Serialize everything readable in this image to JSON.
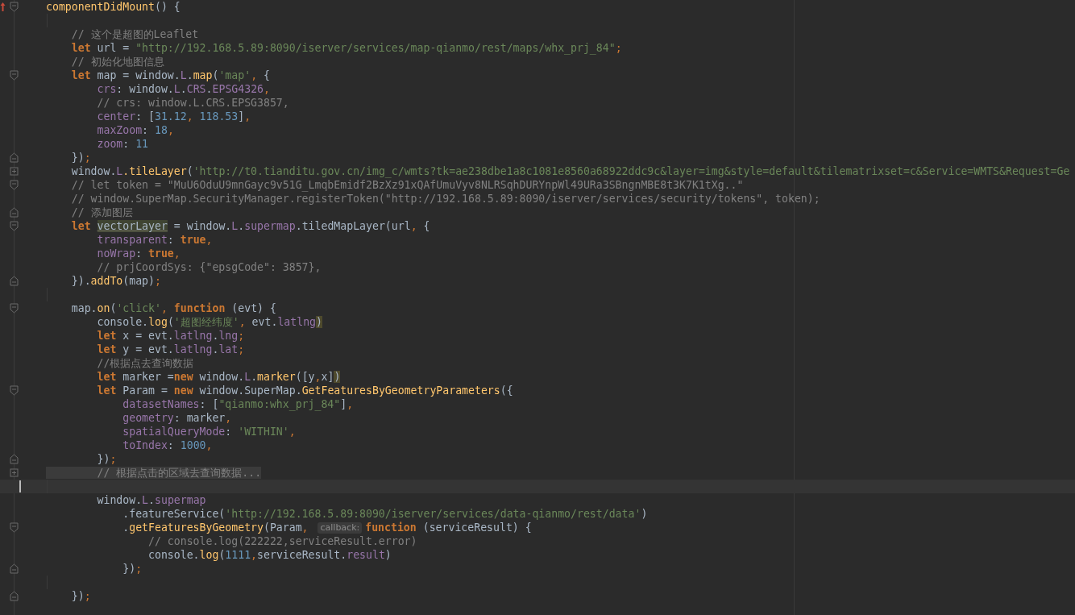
{
  "editor": {
    "lines": [
      {
        "fold": {
          "kind": "open"
        },
        "gutter_icon": {
          "kind": "override"
        },
        "tokens": [
          {
            "text": "componentDidMount",
            "kind": "f"
          },
          {
            "text": "() {",
            "kind": "p"
          }
        ]
      },
      {
        "kind": "blank"
      },
      {
        "tokens": [
          {
            "text": "    // 这个是超图的Leaflet",
            "kind": "c"
          }
        ]
      },
      {
        "tokens": [
          {
            "text": "    let",
            "kind": "kw"
          },
          {
            "text": " url = ",
            "kind": "p"
          },
          {
            "text": "\"http://192.168.5.89:8090/iserver/services/map-qianmo/rest/maps/whx_prj_84\"",
            "kind": "s"
          },
          {
            "text": ";",
            "kind": "o"
          }
        ]
      },
      {
        "tokens": [
          {
            "text": "    // 初始化地图信息",
            "kind": "c"
          }
        ]
      },
      {
        "fold": {
          "kind": "open"
        },
        "tokens": [
          {
            "text": "    let",
            "kind": "kw"
          },
          {
            "text": " map = window.",
            "kind": "p"
          },
          {
            "text": "L",
            "kind": "pr"
          },
          {
            "text": ".",
            "kind": "p"
          },
          {
            "text": "map",
            "kind": "f"
          },
          {
            "text": "(",
            "kind": "p"
          },
          {
            "text": "'map'",
            "kind": "s"
          },
          {
            "text": ", ",
            "kind": "o"
          },
          {
            "text": "{",
            "kind": "p"
          }
        ]
      },
      {
        "tokens": [
          {
            "text": "        crs",
            "kind": "pr"
          },
          {
            "text": ": window.",
            "kind": "p"
          },
          {
            "text": "L",
            "kind": "pr"
          },
          {
            "text": ".",
            "kind": "p"
          },
          {
            "text": "CRS",
            "kind": "pr"
          },
          {
            "text": ".",
            "kind": "p"
          },
          {
            "text": "EPSG4326",
            "kind": "pr"
          },
          {
            "text": ",",
            "kind": "o"
          }
        ]
      },
      {
        "tokens": [
          {
            "text": "        // crs: window.L.CRS.EPSG3857,",
            "kind": "c"
          }
        ]
      },
      {
        "tokens": [
          {
            "text": "        center",
            "kind": "pr"
          },
          {
            "text": ": [",
            "kind": "p"
          },
          {
            "text": "31.12",
            "kind": "n"
          },
          {
            "text": ", ",
            "kind": "o"
          },
          {
            "text": "118.53",
            "kind": "n"
          },
          {
            "text": "]",
            "kind": "p"
          },
          {
            "text": ",",
            "kind": "o"
          }
        ]
      },
      {
        "tokens": [
          {
            "text": "        maxZoom",
            "kind": "pr"
          },
          {
            "text": ": ",
            "kind": "p"
          },
          {
            "text": "18",
            "kind": "n"
          },
          {
            "text": ",",
            "kind": "o"
          }
        ]
      },
      {
        "tokens": [
          {
            "text": "        zoom",
            "kind": "pr"
          },
          {
            "text": ": ",
            "kind": "p"
          },
          {
            "text": "11",
            "kind": "n"
          }
        ]
      },
      {
        "fold": {
          "kind": "close"
        },
        "tokens": [
          {
            "text": "    })",
            "kind": "p"
          },
          {
            "text": ";",
            "kind": "o"
          }
        ]
      },
      {
        "fold": {
          "kind": "plus"
        },
        "tokens": [
          {
            "text": "    window.",
            "kind": "p"
          },
          {
            "text": "L",
            "kind": "pr"
          },
          {
            "text": ".tileLayer",
            "kind": "f"
          },
          {
            "text": "(",
            "kind": "p"
          },
          {
            "text": "'http://t0.tianditu.gov.cn/img_c/wmts?tk=ae238dbe1a8c1081e8560a68922ddc9c&layer=img&style=default&tilematrixset=c&Service=WMTS&Request=Ge",
            "kind": "s"
          }
        ]
      },
      {
        "fold": {
          "kind": "open"
        },
        "tokens": [
          {
            "text": "    // let token = \"MuU6OduU9mnGayc9v51G_LmqbEmidf2BzXz91xQAfUmuVyv8NLRSqhDURYnpWl49URa3SBngnMBE8t3K7K1tXg..\"",
            "kind": "c"
          }
        ]
      },
      {
        "tokens": [
          {
            "text": "    // window.SuperMap.SecurityManager.registerToken(\"http://192.168.5.89:8090/iserver/services/security/tokens\", token);",
            "kind": "c"
          }
        ]
      },
      {
        "fold": {
          "kind": "close"
        },
        "tokens": [
          {
            "text": "    // 添加图层",
            "kind": "c"
          }
        ]
      },
      {
        "fold": {
          "kind": "open"
        },
        "tokens": [
          {
            "text": "    let ",
            "kind": "kw"
          },
          {
            "text": "vectorLayer",
            "kind": "d"
          },
          {
            "text": " = window.",
            "kind": "p"
          },
          {
            "text": "L",
            "kind": "pr"
          },
          {
            "text": ".",
            "kind": "p"
          },
          {
            "text": "supermap",
            "kind": "pr"
          },
          {
            "text": ".tiledMapLayer(url",
            "kind": "p"
          },
          {
            "text": ", ",
            "kind": "o"
          },
          {
            "text": "{",
            "kind": "p"
          }
        ]
      },
      {
        "tokens": [
          {
            "text": "        transparent",
            "kind": "pr"
          },
          {
            "text": ": ",
            "kind": "p"
          },
          {
            "text": "true",
            "kind": "kw"
          },
          {
            "text": ",",
            "kind": "o"
          }
        ]
      },
      {
        "tokens": [
          {
            "text": "        noWrap",
            "kind": "pr"
          },
          {
            "text": ": ",
            "kind": "p"
          },
          {
            "text": "true",
            "kind": "kw"
          },
          {
            "text": ",",
            "kind": "o"
          }
        ]
      },
      {
        "tokens": [
          {
            "text": "        // prjCoordSys: {\"epsgCode\": 3857},",
            "kind": "c"
          }
        ]
      },
      {
        "fold": {
          "kind": "close"
        },
        "tokens": [
          {
            "text": "    }).",
            "kind": "p"
          },
          {
            "text": "addTo",
            "kind": "f"
          },
          {
            "text": "(map)",
            "kind": "p"
          },
          {
            "text": ";",
            "kind": "o"
          }
        ]
      },
      {
        "kind": "blank"
      },
      {
        "fold": {
          "kind": "open"
        },
        "tokens": [
          {
            "text": "    map.",
            "kind": "p"
          },
          {
            "text": "on",
            "kind": "f"
          },
          {
            "text": "(",
            "kind": "p"
          },
          {
            "text": "'click'",
            "kind": "s"
          },
          {
            "text": ", ",
            "kind": "o"
          },
          {
            "text": "function",
            "kind": "kw"
          },
          {
            "text": " (evt) {",
            "kind": "p"
          }
        ]
      },
      {
        "tokens": [
          {
            "text": "        console.",
            "kind": "p"
          },
          {
            "text": "log",
            "kind": "f"
          },
          {
            "text": "(",
            "kind": "p"
          },
          {
            "text": "'超图经纬度'",
            "kind": "s"
          },
          {
            "text": ", ",
            "kind": "o"
          },
          {
            "text": "evt.",
            "kind": "p"
          },
          {
            "text": "latlng",
            "kind": "pr"
          },
          {
            "text": ")",
            "kind": "m"
          }
        ]
      },
      {
        "tokens": [
          {
            "text": "        let",
            "kind": "kw"
          },
          {
            "text": " x = evt.",
            "kind": "p"
          },
          {
            "text": "latlng",
            "kind": "pr"
          },
          {
            "text": ".",
            "kind": "p"
          },
          {
            "text": "lng",
            "kind": "pr"
          },
          {
            "text": ";",
            "kind": "o"
          }
        ]
      },
      {
        "tokens": [
          {
            "text": "        let",
            "kind": "kw"
          },
          {
            "text": " y = evt.",
            "kind": "p"
          },
          {
            "text": "latlng",
            "kind": "pr"
          },
          {
            "text": ".",
            "kind": "p"
          },
          {
            "text": "lat",
            "kind": "pr"
          },
          {
            "text": ";",
            "kind": "o"
          }
        ]
      },
      {
        "tokens": [
          {
            "text": "        //根据点去查询数据",
            "kind": "c"
          }
        ]
      },
      {
        "tokens": [
          {
            "text": "        let",
            "kind": "kw"
          },
          {
            "text": " marker =",
            "kind": "p"
          },
          {
            "text": "new",
            "kind": "kw"
          },
          {
            "text": " window.",
            "kind": "p"
          },
          {
            "text": "L",
            "kind": "pr"
          },
          {
            "text": ".",
            "kind": "p"
          },
          {
            "text": "marker",
            "kind": "f"
          },
          {
            "text": "([y",
            "kind": "p"
          },
          {
            "text": ",",
            "kind": "o"
          },
          {
            "text": "x]",
            "kind": "p"
          },
          {
            "text": ")",
            "kind": "m"
          }
        ]
      },
      {
        "fold": {
          "kind": "open"
        },
        "tokens": [
          {
            "text": "        let",
            "kind": "kw"
          },
          {
            "text": " Param = ",
            "kind": "p"
          },
          {
            "text": "new",
            "kind": "kw"
          },
          {
            "text": " window.SuperMap.",
            "kind": "p"
          },
          {
            "text": "GetFeaturesByGeometryParameters",
            "kind": "f"
          },
          {
            "text": "({",
            "kind": "p"
          }
        ]
      },
      {
        "tokens": [
          {
            "text": "            datasetNames",
            "kind": "pr"
          },
          {
            "text": ": [",
            "kind": "p"
          },
          {
            "text": "\"qianmo:whx_prj_84\"",
            "kind": "s"
          },
          {
            "text": "]",
            "kind": "p"
          },
          {
            "text": ",",
            "kind": "o"
          }
        ]
      },
      {
        "tokens": [
          {
            "text": "            geometry",
            "kind": "pr"
          },
          {
            "text": ": marker",
            "kind": "p"
          },
          {
            "text": ",",
            "kind": "o"
          }
        ]
      },
      {
        "tokens": [
          {
            "text": "            spatialQueryMode",
            "kind": "pr"
          },
          {
            "text": ": ",
            "kind": "p"
          },
          {
            "text": "'WITHIN'",
            "kind": "s"
          },
          {
            "text": ",",
            "kind": "o"
          }
        ]
      },
      {
        "tokens": [
          {
            "text": "            toIndex",
            "kind": "pr"
          },
          {
            "text": ": ",
            "kind": "p"
          },
          {
            "text": "1000",
            "kind": "n"
          },
          {
            "text": ",",
            "kind": "o"
          }
        ]
      },
      {
        "fold": {
          "kind": "close"
        },
        "tokens": [
          {
            "text": "        })",
            "kind": "p"
          },
          {
            "text": ";",
            "kind": "o"
          }
        ]
      },
      {
        "fold": {
          "kind": "plus"
        },
        "tokens": [
          {
            "text": "        // 根据点击的区域去查询数据...",
            "kind": "ch"
          }
        ]
      },
      {
        "kind": "blank",
        "current": true
      },
      {
        "tokens": [
          {
            "text": "        window.",
            "kind": "p"
          },
          {
            "text": "L",
            "kind": "pr"
          },
          {
            "text": ".",
            "kind": "p"
          },
          {
            "text": "supermap",
            "kind": "pr"
          }
        ]
      },
      {
        "tokens": [
          {
            "text": "            .featureService(",
            "kind": "p"
          },
          {
            "text": "'http://192.168.5.89:8090/iserver/services/data-qianmo/rest/data'",
            "kind": "s"
          },
          {
            "text": ")",
            "kind": "p"
          }
        ]
      },
      {
        "fold": {
          "kind": "open"
        },
        "tokens": [
          {
            "text": "            .",
            "kind": "p"
          },
          {
            "text": "getFeaturesByGeometry",
            "kind": "f"
          },
          {
            "text": "(Param",
            "kind": "p"
          },
          {
            "text": ", ",
            "kind": "o"
          },
          {
            "text": "callback:",
            "kind": "h"
          },
          {
            "text": "function",
            "kind": "kw"
          },
          {
            "text": " (serviceResult) {",
            "kind": "p"
          }
        ]
      },
      {
        "tokens": [
          {
            "text": "                // console.log(222222,serviceResult.error)",
            "kind": "c"
          }
        ]
      },
      {
        "tokens": [
          {
            "text": "                console.",
            "kind": "p"
          },
          {
            "text": "log",
            "kind": "f"
          },
          {
            "text": "(",
            "kind": "p"
          },
          {
            "text": "1111",
            "kind": "n"
          },
          {
            "text": ",",
            "kind": "o"
          },
          {
            "text": "serviceResult.",
            "kind": "p"
          },
          {
            "text": "result",
            "kind": "pr"
          },
          {
            "text": ")",
            "kind": "p"
          }
        ]
      },
      {
        "fold": {
          "kind": "close"
        },
        "tokens": [
          {
            "text": "            })",
            "kind": "p"
          },
          {
            "text": ";",
            "kind": "o"
          }
        ]
      },
      {
        "kind": "blank"
      },
      {
        "fold": {
          "kind": "close"
        },
        "tokens": [
          {
            "text": "    })",
            "kind": "p"
          },
          {
            "text": ";",
            "kind": "o"
          }
        ]
      }
    ]
  }
}
